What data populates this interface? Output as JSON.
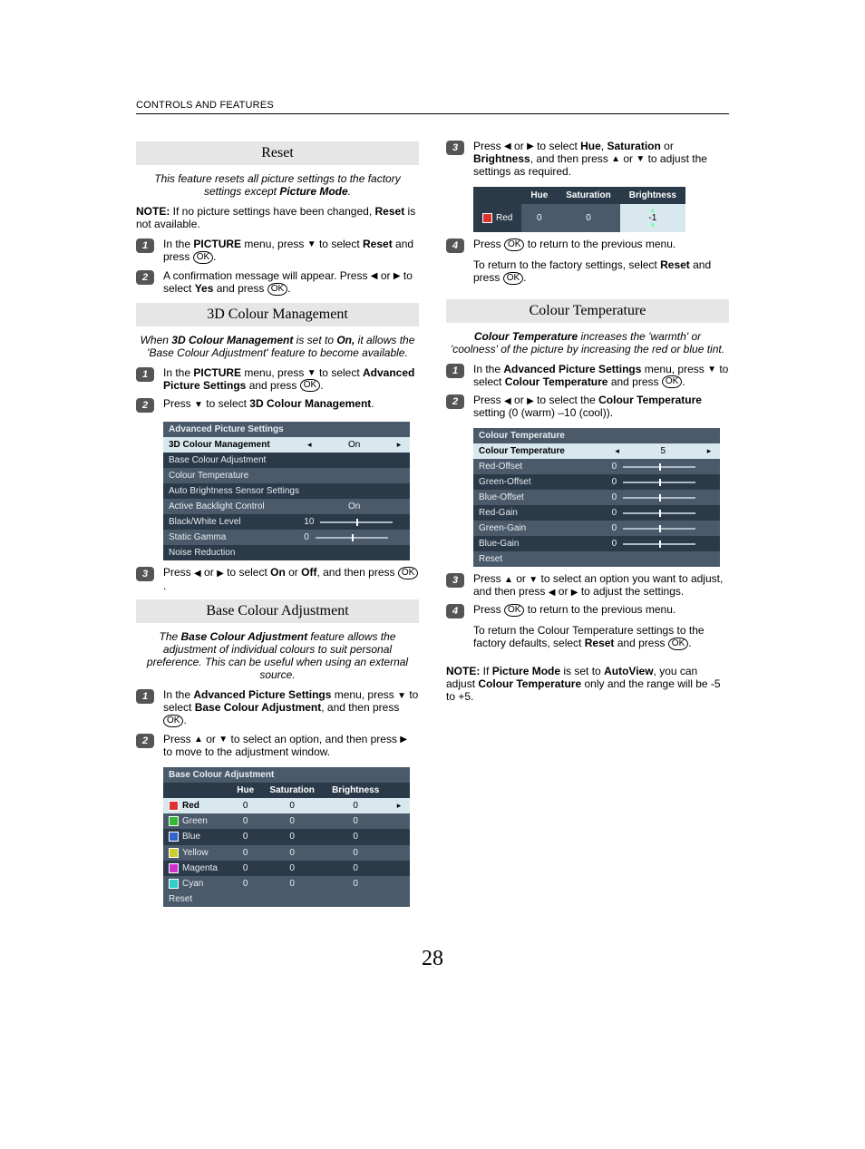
{
  "header": "CONTROLS AND FEATURES",
  "glyph": {
    "left": "◀",
    "right": "▶",
    "up": "▲",
    "down": "▼",
    "ok": "OK",
    "smallright": "▸",
    "smallleft": "◂"
  },
  "s1": {
    "title": "Reset",
    "intro1": "This feature resets all picture settings to the factory settings except ",
    "intro1b": "Picture Mode",
    "intro1c": ".",
    "note": "NOTE:",
    "noteText": " If no picture settings have been changed, ",
    "noteB": "Reset",
    "noteText2": " is not available.",
    "step1a": "In the ",
    "step1b": "PICTURE",
    "step1c": " menu, press ",
    "step1d": " to select ",
    "step1e": "Reset",
    "step1f": " and press ",
    "step2a": "A confirmation message will appear. Press ",
    "step2b": " or ",
    "step2c": " to select ",
    "step2d": "Yes",
    "step2e": " and press "
  },
  "s2": {
    "title": "3D Colour Management",
    "intro1": "When ",
    "intro1b": "3D Colour Management",
    "intro1c": " is set to ",
    "intro1d": "On,",
    "intro1e": " it allows the 'Base Colour Adjustment' feature to become available.",
    "step1a": "In the ",
    "step1b": "PICTURE",
    "step1c": " menu, press ",
    "step1d": " to select ",
    "step1e": "Advanced Picture Settings",
    "step1f": " and press ",
    "step2a": "Press ",
    "step2b": " to select ",
    "step2c": "3D Colour Management",
    "step3a": "Press ",
    "step3b": " or ",
    "step3c": " to select ",
    "step3d": "On",
    "step3e": " or ",
    "step3f": "Off",
    "step3g": ", and then press ",
    "osdTitle": "Advanced Picture Settings",
    "rows": [
      {
        "label": "3D Colour Management",
        "value": "On",
        "active": true,
        "arrows": true
      },
      {
        "label": "Base Colour Adjustment"
      },
      {
        "label": "Colour Temperature"
      },
      {
        "label": "Auto Brightness Sensor Settings"
      },
      {
        "label": "Active Backlight Control",
        "value": "On"
      },
      {
        "label": "Black/White Level",
        "value": "10",
        "slider": true
      },
      {
        "label": "Static Gamma",
        "value": "0",
        "slider": true
      },
      {
        "label": "Noise Reduction"
      }
    ]
  },
  "s3": {
    "title": "Base Colour Adjustment",
    "intro1": "The ",
    "intro1b": "Base Colour Adjustment",
    "intro1c": " feature allows the adjustment of individual colours to suit personal preference. This can be useful when using an external source.",
    "step1a": "In the ",
    "step1b": "Advanced Picture Settings",
    "step1c": " menu, press ",
    "step1d": " to select ",
    "step1e": "Base Colour Adjustment",
    "step1f": ", and then press ",
    "step2a": "Press ",
    "step2b": " or ",
    "step2c": " to select an option, and then press ",
    "step2d": " to move to the adjustment window.",
    "osdTitle": "Base Colour Adjustment",
    "headers": [
      "Hue",
      "Saturation",
      "Brightness"
    ],
    "rows": [
      {
        "name": "Red",
        "c": "#d33",
        "h": "0",
        "s": "0",
        "b": "0",
        "active": true
      },
      {
        "name": "Green",
        "c": "#3b3",
        "h": "0",
        "s": "0",
        "b": "0"
      },
      {
        "name": "Blue",
        "c": "#36c",
        "h": "0",
        "s": "0",
        "b": "0"
      },
      {
        "name": "Yellow",
        "c": "#cc3",
        "h": "0",
        "s": "0",
        "b": "0"
      },
      {
        "name": "Magenta",
        "c": "#c3c",
        "h": "0",
        "s": "0",
        "b": "0"
      },
      {
        "name": "Cyan",
        "c": "#3cc",
        "h": "0",
        "s": "0",
        "b": "0"
      }
    ],
    "reset": "Reset"
  },
  "r1": {
    "step3a": "Press ",
    "step3b": " or ",
    "step3c": " to select ",
    "step3d": "Hue",
    "step3e": ", ",
    "step3f": "Saturation",
    "step3g": " or ",
    "step3h": "Brightness",
    "step3i": ", and then press ",
    "step3j": " or ",
    "step3k": " to adjust the settings as required.",
    "osd": {
      "label": "Red",
      "h": "Hue",
      "s": "Saturation",
      "b": "Brightness",
      "hv": "0",
      "sv": "0",
      "bv": "-1"
    },
    "step4a": "Press ",
    "step4b": " to return to the previous menu.",
    "step4c": "To return to the factory settings, select ",
    "step4d": "Reset",
    "step4e": " and press "
  },
  "s4": {
    "title": "Colour Temperature",
    "intro1": "Colour Temperature",
    "intro1b": " increases the 'warmth' or 'coolness' of the picture by increasing the red or blue tint.",
    "step1a": "In the ",
    "step1b": "Advanced Picture Settings",
    "step1c": " menu, press ",
    "step1d": " to select ",
    "step1e": "Colour Temperature",
    "step1f": " and press ",
    "step2a": "Press ",
    "step2b": " or ",
    "step2c": " to select the ",
    "step2d": "Colour Temperature",
    "step2e": " setting (0 (warm) –10 (cool)).",
    "osdTitle": "Colour Temperature",
    "rows": [
      {
        "label": "Colour Temperature",
        "value": "5",
        "active": true,
        "arrows": true
      },
      {
        "label": "Red-Offset",
        "value": "0",
        "slider": true
      },
      {
        "label": "Green-Offset",
        "value": "0",
        "slider": true
      },
      {
        "label": "Blue-Offset",
        "value": "0",
        "slider": true
      },
      {
        "label": "Red-Gain",
        "value": "0",
        "slider": true
      },
      {
        "label": "Green-Gain",
        "value": "0",
        "slider": true
      },
      {
        "label": "Blue-Gain",
        "value": "0",
        "slider": true
      },
      {
        "label": "Reset"
      }
    ],
    "step3a": "Press ",
    "step3b": " or ",
    "step3c": " to select an option you want to adjust, and then press ",
    "step3d": " or ",
    "step3e": " to adjust the settings.",
    "step4a": "Press ",
    "step4b": " to return to the previous menu.",
    "step4c": "To return the Colour Temperature settings to the factory defaults, select ",
    "step4d": "Reset",
    "step4e": " and press ",
    "noteLabel": "NOTE:",
    "note1": " If ",
    "note2": "Picture Mode",
    "note3": " is set to ",
    "note4": "AutoView",
    "note5": ", you can adjust ",
    "note6": "Colour Temperature",
    "note7": " only and the range will be -5 to +5."
  },
  "pageNum": "28"
}
